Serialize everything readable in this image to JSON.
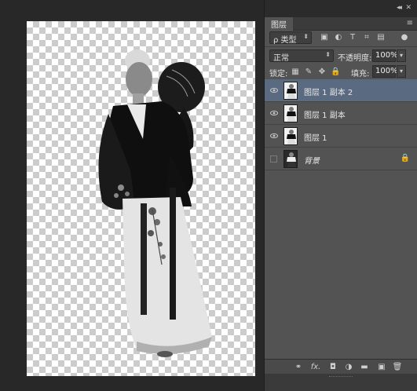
{
  "panel": {
    "collapse_glyph": "◂◂",
    "close_glyph": "✕",
    "tab_label": "图层",
    "menu_glyph": "≡",
    "filter": {
      "kind_label": "ρ 类型",
      "icons": [
        "pixel-filter-icon",
        "adjustment-filter-icon",
        "type-filter-icon",
        "shape-filter-icon",
        "smart-object-filter-icon",
        "filter-toggle-icon"
      ],
      "icon_glyphs": [
        "▣",
        "◐",
        "T",
        "⌗",
        "▤",
        "●"
      ]
    },
    "blend": {
      "mode": "正常",
      "opacity_label": "不透明度:",
      "opacity_value": "100%"
    },
    "lock": {
      "label": "锁定:",
      "icon_glyphs": [
        "▦",
        "✎",
        "✥",
        "🔒"
      ],
      "fill_label": "填充:",
      "fill_value": "100%"
    },
    "layers": [
      {
        "name": "图层 1 副本 2",
        "visible": true,
        "selected": true
      },
      {
        "name": "图层 1 副本",
        "visible": true,
        "selected": false
      },
      {
        "name": "图层 1",
        "visible": true,
        "selected": false
      },
      {
        "name": "背景",
        "visible": false,
        "selected": false,
        "locked": true
      }
    ],
    "bottom_icons": [
      "link-layers-icon",
      "fx-icon",
      "layer-mask-icon",
      "adjustment-layer-icon",
      "group-folder-icon",
      "new-layer-icon",
      "trash-icon"
    ],
    "bottom_glyphs": [
      "⚭",
      "fx.",
      "◘",
      "◑",
      "▬",
      "▣",
      "🗑"
    ]
  },
  "colors": {
    "panel_bg": "#535353",
    "selected_row": "#5a6a80",
    "canvas_checker": "#cccccc"
  }
}
